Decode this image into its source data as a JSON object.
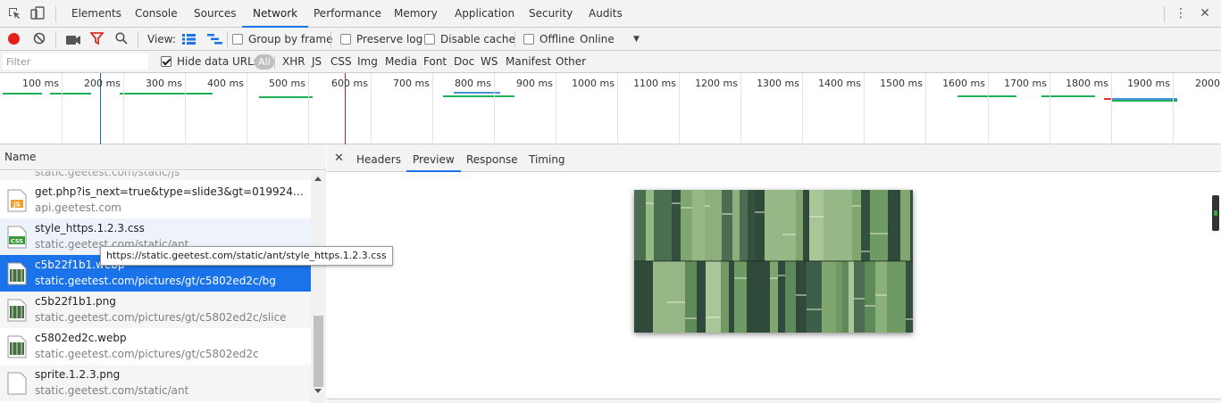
{
  "tabs": [
    "Elements",
    "Console",
    "Sources",
    "Network",
    "Performance",
    "Memory",
    "Application",
    "Security",
    "Audits"
  ],
  "active_tab": "Network",
  "toolbar": {
    "view_label": "View:",
    "group_by_frame": "Group by frame",
    "preserve_log": "Preserve log",
    "disable_cache": "Disable cache",
    "offline": "Offline",
    "throttle_value": "Online"
  },
  "filterbar": {
    "placeholder": "Filter",
    "hide_data_urls": "Hide data URLs",
    "types": [
      "All",
      "XHR",
      "JS",
      "CSS",
      "Img",
      "Media",
      "Font",
      "Doc",
      "WS",
      "Manifest",
      "Other"
    ]
  },
  "overview": {
    "ticks": [
      "100 ms",
      "200 ms",
      "300 ms",
      "400 ms",
      "500 ms",
      "600 ms",
      "700 ms",
      "800 ms",
      "900 ms",
      "1000 ms",
      "1100 ms",
      "1200 ms",
      "1300 ms",
      "1400 ms",
      "1500 ms",
      "1600 ms",
      "1700 ms",
      "1800 ms",
      "1900 ms",
      "2000"
    ]
  },
  "list": {
    "header": "Name",
    "partial_row": "static.geetest.com/static/js",
    "rows": [
      {
        "name": "get.php?is_next=true&type=slide3&gt=019924a82c70bb...",
        "domain": "api.geetest.com",
        "icon": "js-file-icon"
      },
      {
        "name": "style_https.1.2.3.css",
        "domain": "static.geetest.com/static/ant",
        "icon": "css-file-icon"
      },
      {
        "name": "c5b22f1b1.webp",
        "domain": "static.geetest.com/pictures/gt/c5802ed2c/bg",
        "icon": "image-file-icon"
      },
      {
        "name": "c5b22f1b1.png",
        "domain": "static.geetest.com/pictures/gt/c5802ed2c/slice",
        "icon": "image-file-icon"
      },
      {
        "name": "c5802ed2c.webp",
        "domain": "static.geetest.com/pictures/gt/c5802ed2c",
        "icon": "image-file-icon"
      },
      {
        "name": "sprite.1.2.3.png",
        "domain": "static.geetest.com/static/ant",
        "icon": "blank-file-icon"
      }
    ],
    "selected_index": 2
  },
  "tooltip": "https://static.geetest.com/static/ant/style_https.1.2.3.css",
  "details": {
    "tabs": [
      "Headers",
      "Preview",
      "Response",
      "Timing"
    ],
    "active": "Preview"
  },
  "colors": {
    "accent": "#1a73e8",
    "record": "#e3211b",
    "filter_icon": "#d93025"
  }
}
